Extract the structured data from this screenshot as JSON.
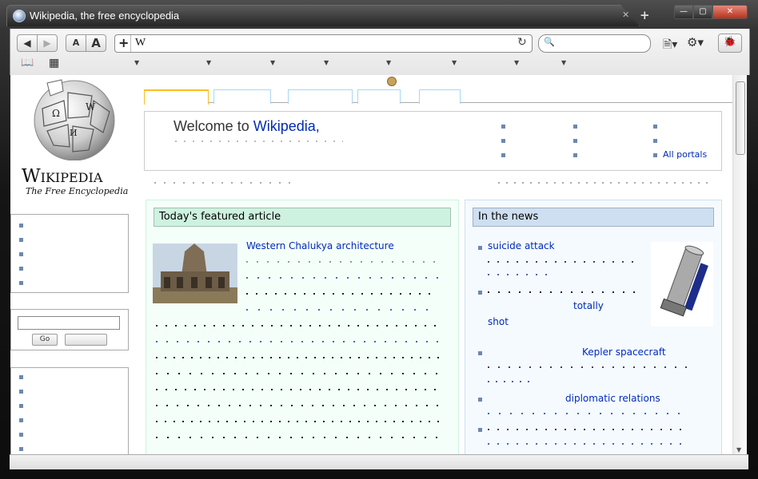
{
  "window": {
    "tab_title": "Wikipedia, the free encyclopedia",
    "tab_close": "✕",
    "new_tab": "+",
    "minimize": "—",
    "maximize": "▢",
    "close": "✕"
  },
  "toolbar": {
    "back": "◀",
    "forward": "▶",
    "text_smaller": "A",
    "text_larger": "A",
    "add": "+",
    "url_value": "W",
    "reload": "↻",
    "search_icon": "🔍",
    "page_menu": "🗎▾",
    "settings_menu": "⚙▾",
    "bug": "🐞"
  },
  "bookmarks_bar": {
    "book_icon": "📖",
    "grid_icon": "▦",
    "arrows": [
      "▼",
      "▼",
      "▼",
      "▼",
      "▼",
      "▼",
      "▼",
      "▼"
    ]
  },
  "wiki": {
    "logo_title": "Wikipedia",
    "logo_subtitle": "The Free Encyclopedia",
    "welcome_prefix": "Welcome to ",
    "welcome_link": "Wikipedia,",
    "right_link": "All portals",
    "search_go": "Go",
    "featured_header": "Today's featured article",
    "featured_link": "Western Chalukya architecture",
    "news_header": "In the news",
    "news_items": [
      "suicide attack",
      "totally",
      "shot",
      "Kepler spacecraft",
      "diplomatic relations"
    ]
  },
  "colors": {
    "featured_bg": "#f5fffa",
    "featured_header": "#cef2e0",
    "news_bg": "#f5faff",
    "news_header": "#cedff2",
    "link": "#002bb8"
  }
}
